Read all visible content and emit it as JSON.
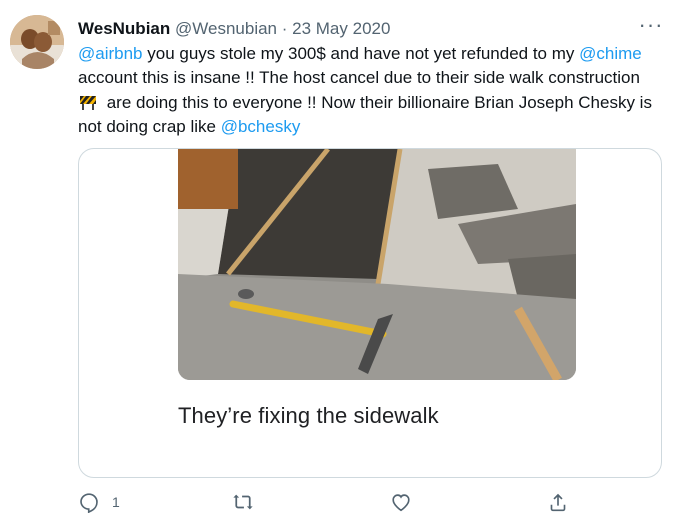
{
  "tweet": {
    "display_name": "WesNubian",
    "handle": "@Wesnubian",
    "separator": "·",
    "date": "23 May 2020",
    "more_label": "···",
    "text": {
      "m1": "@airbnb",
      "t1": " you guys stole my 300$ and have not yet refunded to my ",
      "m2": "@chime",
      "t2": " account  this is insane !! The host cancel due to their side walk construction ",
      "t3": " are doing this to everyone !! Now their billionaire Brian Joseph Chesky is not doing crap like ",
      "m3": "@bchesky"
    },
    "emoji": "construction-sign",
    "card": {
      "caption": "They’re fixing the sidewalk"
    },
    "actions": {
      "reply_count": "1"
    }
  },
  "colors": {
    "accent": "#1d9bf0",
    "muted": "#536471",
    "border": "#cfd9de"
  }
}
